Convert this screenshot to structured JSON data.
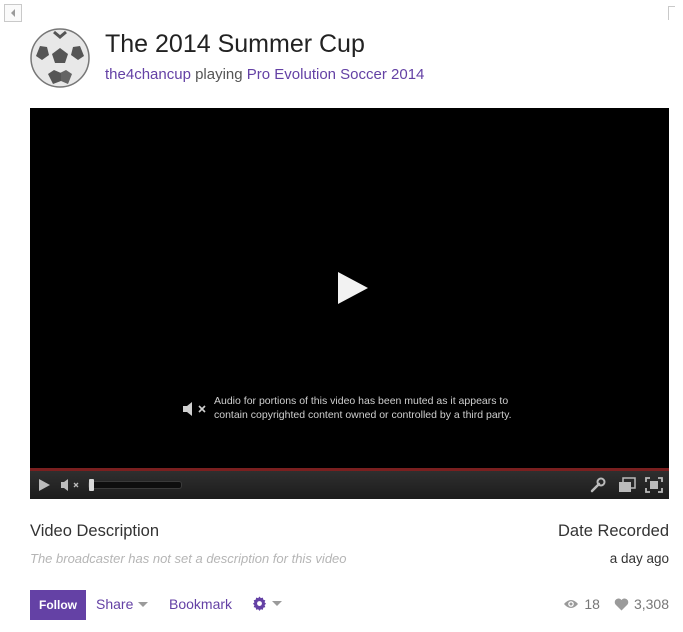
{
  "header": {
    "title": "The 2014 Summer Cup",
    "channel": "the4chancup",
    "playing_word": "playing",
    "game": "Pro Evolution Soccer 2014"
  },
  "player": {
    "muted_notice": "Audio for portions of this video has been muted as it appears to contain copyrighted content owned or controlled by a third party.",
    "volume_level": 0.0
  },
  "description": {
    "heading": "Video Description",
    "text": "The broadcaster has not set a description for this video"
  },
  "date": {
    "heading": "Date Recorded",
    "value": "a day ago"
  },
  "actions": {
    "follow": "Follow",
    "share": "Share",
    "bookmark": "Bookmark"
  },
  "stats": {
    "views": "18",
    "likes": "3,308"
  },
  "colors": {
    "accent": "#6441a5",
    "player_bg": "#000000"
  },
  "icons": [
    "collapse-arrow-icon",
    "soccer-ball-avatar",
    "play-icon",
    "mute-icon",
    "volume-icon",
    "wrench-icon",
    "popout-icon",
    "fullscreen-icon",
    "gear-icon",
    "eye-icon",
    "heart-icon"
  ]
}
